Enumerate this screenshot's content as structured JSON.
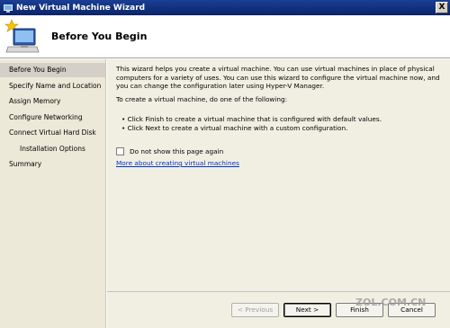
{
  "window": {
    "title": "New Virtual Machine Wizard",
    "close_glyph": "X"
  },
  "header": {
    "title": "Before You Begin",
    "icon": "computer-new-icon"
  },
  "sidebar": {
    "items": [
      {
        "label": "Before You Begin"
      },
      {
        "label": "Specify Name and Location"
      },
      {
        "label": "Assign Memory"
      },
      {
        "label": "Configure Networking"
      },
      {
        "label": "Connect Virtual Hard Disk"
      },
      {
        "label": "Installation Options"
      },
      {
        "label": "Summary"
      }
    ]
  },
  "content": {
    "intro": "This wizard helps you create a virtual machine. You can use virtual machines in place of physical computers for a variety of uses. You can use this wizard to configure the virtual machine now, and you can change the configuration later using Hyper-V Manager.",
    "to_create": "To create a virtual machine, do one of the following:",
    "bullets": [
      "Click Finish to create a virtual machine that is configured with default values.",
      "Click Next to create a virtual machine with a custom configuration."
    ],
    "checkbox_label": "Do not show this page again",
    "more_link": "More about creating virtual machines"
  },
  "footer": {
    "prev_label": "< Previous",
    "next_label": "Next >",
    "finish_label": "Finish",
    "cancel_label": "Cancel"
  },
  "watermark": {
    "text": "ZOL.COM.CN"
  },
  "colors": {
    "titlebar": "#0a246a",
    "sidebar": "#ece9d8",
    "content": "#f1efe2",
    "link": "#0033cc"
  }
}
